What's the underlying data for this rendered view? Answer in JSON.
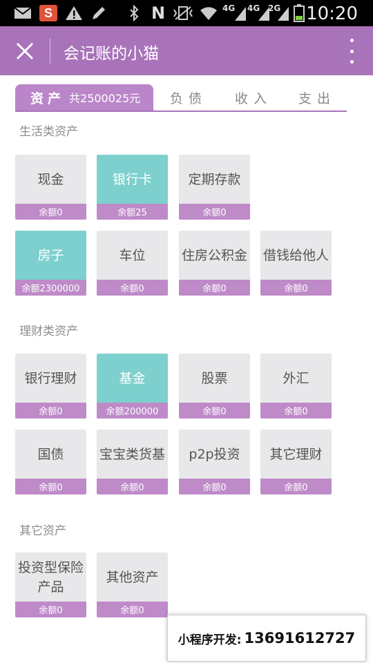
{
  "status_bar": {
    "time": "10:20",
    "network_labels": [
      "4G",
      "4G",
      "2G"
    ],
    "icons": [
      "mail-icon",
      "sohu-icon",
      "warning-icon",
      "pen-icon",
      "bluetooth-icon",
      "nfc-icon",
      "vibrate-icon",
      "wifi-icon",
      "signal-icon",
      "battery-icon"
    ]
  },
  "header": {
    "title": "会记账的小猫",
    "close_icon": "close-icon",
    "more_icon": "more-vert-icon",
    "bg_color": "#a873b9"
  },
  "tabs": [
    {
      "label": "资产",
      "total": "共2500025元",
      "active": true
    },
    {
      "label": "负债"
    },
    {
      "label": "收入"
    },
    {
      "label": "支出"
    }
  ],
  "sections": [
    {
      "title": "生活类资产",
      "items": [
        {
          "name": "现金",
          "balance": "余额0",
          "active": false
        },
        {
          "name": "银行卡",
          "balance": "余额25",
          "active": true
        },
        {
          "name": "定期存款",
          "balance": "余额0",
          "active": false
        },
        {
          "name": "房子",
          "balance": "余额2300000",
          "active": true
        },
        {
          "name": "车位",
          "balance": "余额0",
          "active": false
        },
        {
          "name": "住房公积金",
          "balance": "余额0",
          "active": false
        },
        {
          "name": "借钱给他人",
          "balance": "余额0",
          "active": false
        }
      ]
    },
    {
      "title": "理财类资产",
      "items": [
        {
          "name": "银行理财",
          "balance": "余额0",
          "active": false
        },
        {
          "name": "基金",
          "balance": "余额200000",
          "active": true
        },
        {
          "name": "股票",
          "balance": "余额0",
          "active": false
        },
        {
          "name": "外汇",
          "balance": "余额0",
          "active": false
        },
        {
          "name": "国债",
          "balance": "余额0",
          "active": false
        },
        {
          "name": "宝宝类货基",
          "balance": "余额0",
          "active": false
        },
        {
          "name": "p2p投资",
          "balance": "余额0",
          "active": false
        },
        {
          "name": "其它理财",
          "balance": "余额0",
          "active": false
        }
      ]
    },
    {
      "title": "其它资产",
      "items": [
        {
          "name": "投资型保险产品",
          "balance": "余额0",
          "active": false
        },
        {
          "name": "其他资产",
          "balance": "余额0",
          "active": false
        }
      ]
    }
  ],
  "promo": {
    "label": "小程序开发:",
    "phone": "13691612727"
  },
  "colors": {
    "accent": "#a873b9",
    "active_card": "#7dd0cd",
    "card": "#e8e8ea",
    "balance_bar": "#be8ac8"
  }
}
